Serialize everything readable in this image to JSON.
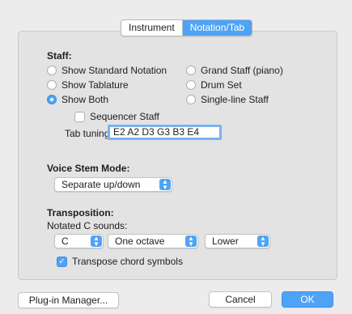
{
  "tabs": {
    "instrument": "Instrument",
    "notation": "Notation/Tab"
  },
  "staff": {
    "heading": "Staff:",
    "options": {
      "standard": "Show Standard Notation",
      "tablature": "Show Tablature",
      "both": "Show Both",
      "grand": "Grand Staff (piano)",
      "drum": "Drum Set",
      "single": "Single-line Staff"
    },
    "selected": "Show Both",
    "sequencer": "Sequencer Staff",
    "tab_tuning_label": "Tab tuning:",
    "tab_tuning_value": "E2 A2 D3 G3 B3 E4"
  },
  "voice": {
    "heading": "Voice Stem Mode:",
    "value": "Separate up/down"
  },
  "transposition": {
    "heading": "Transposition:",
    "sub": "Notated C sounds:",
    "note": "C",
    "interval": "One octave",
    "direction": "Lower",
    "transpose_chords": "Transpose chord symbols",
    "transpose_checked": true
  },
  "footer": {
    "plugin": "Plug-in Manager...",
    "cancel": "Cancel",
    "ok": "OK"
  },
  "colors": {
    "accent": "#4ea3f7"
  }
}
